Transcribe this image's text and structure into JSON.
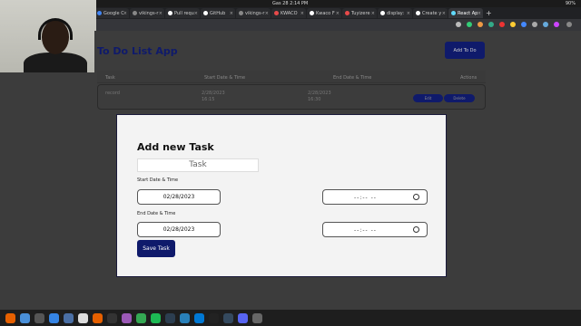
{
  "system_bar": {
    "clock": "Gas 28   2:14 PM",
    "status": "90%"
  },
  "browser": {
    "tabs": [
      {
        "label": "Google C",
        "color": "#4285f4"
      },
      {
        "label": "vikings-r",
        "color": "#888888"
      },
      {
        "label": "Pull requ",
        "color": "#ffffff"
      },
      {
        "label": "GitHub",
        "color": "#ffffff"
      },
      {
        "label": "vikings-r",
        "color": "#888888"
      },
      {
        "label": "KWACO",
        "color": "#e84a4a"
      },
      {
        "label": "Kwaco F",
        "color": "#ffffff"
      },
      {
        "label": "Tuyizere",
        "color": "#e84a4a"
      },
      {
        "label": "display:",
        "color": "#ffffff"
      },
      {
        "label": "Create y",
        "color": "#ffffff"
      },
      {
        "label": "React Ap",
        "color": "#61dafb",
        "active": true
      }
    ],
    "new_tab": "+"
  },
  "app": {
    "title": "To Do List App",
    "add_button": "Add To Do",
    "table": {
      "headers": [
        "Task",
        "Start Date & Time",
        "End Date & Time",
        "Actions"
      ],
      "row": {
        "task": "record",
        "start_date": "2/28/2023",
        "start_time": "16:15",
        "end_date": "2/28/2023",
        "end_time": "16:30",
        "edit": "Edit",
        "delete": "Delete"
      }
    }
  },
  "modal": {
    "title": "Add new Task",
    "task_placeholder": "Task",
    "start_label": "Start Date & Time",
    "start_date": "02/28/2023",
    "start_time": "--:-- --",
    "end_label": "End Date & Time",
    "end_date": "02/28/2023",
    "end_time": "--:-- --",
    "save_button": "Save Task"
  },
  "taskbar": {
    "icons": [
      {
        "name": "firefox-icon",
        "color": "#e66000"
      },
      {
        "name": "files-icon",
        "color": "#4a90d9"
      },
      {
        "name": "terminal-icon",
        "color": "#555555"
      },
      {
        "name": "help-icon",
        "color": "#3584e4"
      },
      {
        "name": "file-manager-icon",
        "color": "#4a6fa5"
      },
      {
        "name": "trash-icon",
        "color": "#dddddd"
      },
      {
        "name": "software-icon",
        "color": "#e66000"
      },
      {
        "name": "inkscape-icon",
        "color": "#333333"
      },
      {
        "name": "podcast-icon",
        "color": "#9b59b6"
      },
      {
        "name": "chrome-icon",
        "color": "#34a853"
      },
      {
        "name": "spotify-icon",
        "color": "#1db954"
      },
      {
        "name": "video-icon",
        "color": "#2c3e50"
      },
      {
        "name": "jetbrains-icon",
        "color": "#2980b9"
      },
      {
        "name": "vscode-icon",
        "color": "#0078d4"
      },
      {
        "name": "obs-icon",
        "color": "#222222"
      },
      {
        "name": "screenshot-icon",
        "color": "#34495e"
      },
      {
        "name": "discord-icon",
        "color": "#5865f2"
      },
      {
        "name": "apps-grid-icon",
        "color": "#666666"
      }
    ]
  }
}
